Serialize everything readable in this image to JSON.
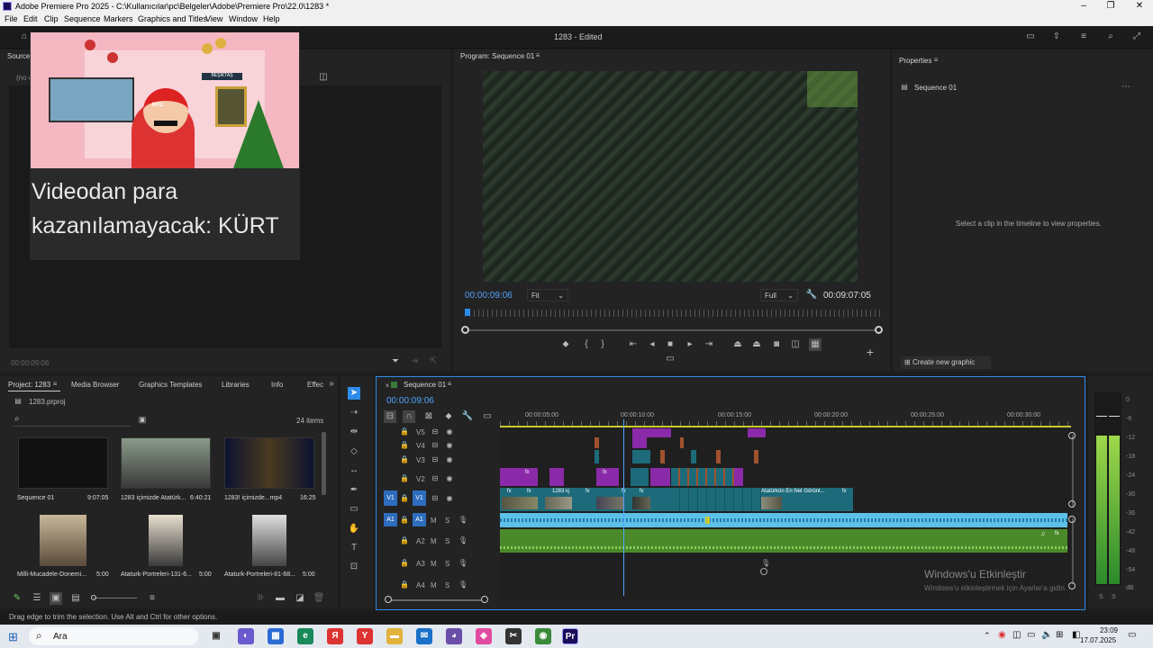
{
  "window": {
    "title": "Adobe Premiere Pro 2025 - C:\\Kullanıcılar\\pc\\Belgeler\\Adobe\\Premiere Pro\\22.0\\1283 *",
    "minimize": "–",
    "maximize": "❐",
    "close": "✕"
  },
  "menu": [
    "File",
    "Edit",
    "Clip",
    "Sequence",
    "Markers",
    "Graphics and Titles",
    "View",
    "Window",
    "Help"
  ],
  "header": {
    "project_status": "1283 - Edited"
  },
  "source_panel": {
    "title": "Source:",
    "no_clip": "(no c",
    "timecode": "00:00:09:06"
  },
  "overlay_video": {
    "caption_line1": "Videodan para",
    "caption_line2": "kazanılamayacak: KÜRT",
    "kfc": "KFC",
    "besiktas": "BEŞİKTAŞ"
  },
  "program_monitor": {
    "title": "Program: Sequence 01",
    "current_time": "00:00:09:06",
    "zoom": "Fit",
    "resolution": "Full",
    "duration": "00:09:07:05"
  },
  "properties_panel": {
    "title": "Properties",
    "sequence": "Sequence 01",
    "empty_message": "Select a clip in the timeline to view properties.",
    "create_graphic": "Create new graphic"
  },
  "project_panel": {
    "tabs": [
      "Project: 1283",
      "Media Browser",
      "Graphics Templates",
      "Libraries",
      "Info",
      "Effec"
    ],
    "file": "1283.prproj",
    "item_count": "24 items",
    "items": [
      {
        "name": "Sequence 01",
        "duration": "9:07:05"
      },
      {
        "name": "1283 içimizde Atatürk...",
        "duration": "6:40:21"
      },
      {
        "name": "1283! içimizde...mp4",
        "duration": "16:25"
      },
      {
        "name": "Milli-Mucadele-Donemi...",
        "duration": "5:00"
      },
      {
        "name": "Ataturk-Portreleri-131-6...",
        "duration": "5:00"
      },
      {
        "name": "Ataturk-Portreleri-81-68...",
        "duration": "5:00"
      }
    ]
  },
  "timeline": {
    "title": "Sequence 01",
    "timecode": "00:00:09:06",
    "ruler": [
      "00:00:05:00",
      "00:00:10:00",
      "00:00:15:00",
      "00:00:20:00",
      "00:00:25:00",
      "00:00:30:00"
    ],
    "video_tracks": [
      "V5",
      "V4",
      "V3",
      "V2",
      "V1"
    ],
    "audio_tracks": [
      "A1",
      "A2",
      "A3",
      "A4"
    ],
    "track_toggles": {
      "mute": "M",
      "solo": "S"
    },
    "source_patch_v": "V1",
    "source_patch_a": "A1",
    "fx": "fx",
    "clip_v1_label": "1283 iç",
    "clip_v1_label2": "Atatürkün En Net Görünt..."
  },
  "audio_meter": {
    "scale": [
      "0",
      "-6",
      "-12",
      "-18",
      "-24",
      "-30",
      "-36",
      "-42",
      "-48",
      "-54",
      "dB"
    ],
    "solo": "S"
  },
  "watermark": {
    "line1": "Windows'u Etkinleştir",
    "line2": "Windows'u etkinleştirmek için Ayarlar'a gidin."
  },
  "status_bar": "Drag edge to trim the selection. Use Alt and Ctrl for other options.",
  "taskbar": {
    "search": "Ara",
    "time": "23:09",
    "date": "17.07.2025"
  },
  "colors": {
    "accent_blue": "#2d8ceb",
    "clip_purple": "#8a2aa8",
    "clip_teal": "#1d6b7a",
    "audio_blue": "#5cc0e8",
    "audio_green": "#4a8a2a"
  }
}
